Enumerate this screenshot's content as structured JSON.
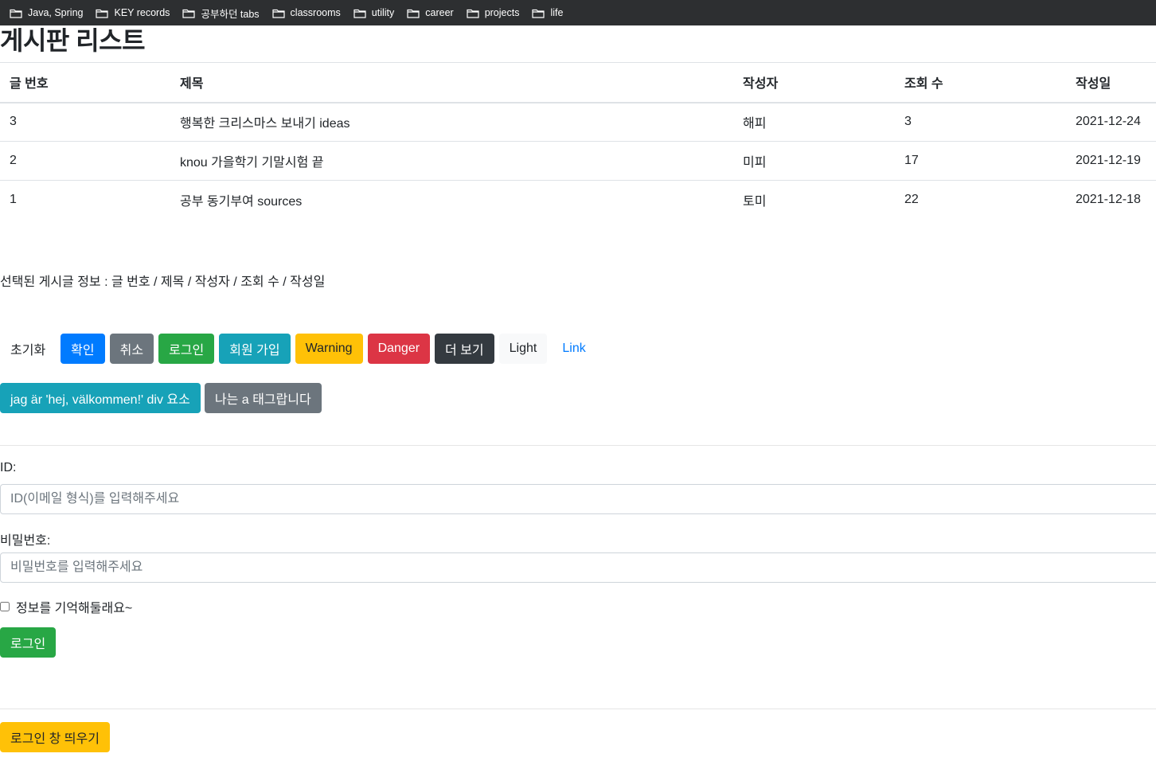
{
  "bookmarks": [
    {
      "label": "Java, Spring",
      "icon": "folder-icon"
    },
    {
      "label": "KEY records",
      "icon": "folder-icon"
    },
    {
      "label": "공부하던 tabs",
      "icon": "folder-icon"
    },
    {
      "label": "classrooms",
      "icon": "folder-icon"
    },
    {
      "label": "utility",
      "icon": "folder-icon"
    },
    {
      "label": "career",
      "icon": "folder-icon"
    },
    {
      "label": "projects",
      "icon": "folder-icon"
    },
    {
      "label": "life",
      "icon": "folder-icon"
    }
  ],
  "page": {
    "title": "게시판 리스트"
  },
  "table": {
    "headers": [
      "글 번호",
      "제목",
      "작성자",
      "조회 수",
      "작성일"
    ],
    "rows": [
      {
        "no": "3",
        "title": "행복한 크리스마스 보내기 ideas",
        "author": "해피",
        "views": "3",
        "date": "2021-12-24"
      },
      {
        "no": "2",
        "title": "knou 가을학기 기말시험 끝",
        "author": "미피",
        "views": "17",
        "date": "2021-12-19"
      },
      {
        "no": "1",
        "title": "공부 동기부여 sources",
        "author": "토미",
        "views": "22",
        "date": "2021-12-18"
      }
    ]
  },
  "selected_info": "선택된 게시글 정보 : 글 번호 / 제목 / 작성자 / 조회 수 / 작성일",
  "buttons_row1": {
    "reset": "초기화",
    "confirm": "확인",
    "cancel": "취소",
    "login": "로그인",
    "signup": "회원 가입",
    "warning": "Warning",
    "danger": "Danger",
    "more": "더 보기",
    "light": "Light",
    "link": "Link"
  },
  "buttons_row2": {
    "div_button": "jag är 'hej, välkommen!' div 요소",
    "a_button": "나는 a 태그랍니다"
  },
  "form": {
    "id_label": "ID:",
    "id_placeholder": "ID(이메일 형식)를 입력해주세요",
    "pw_label": "비밀번호:",
    "pw_placeholder": "비밀번호를 입력해주세요",
    "remember_label": "정보를 기억해둘래요~",
    "submit": "로그인"
  },
  "open_login": "로그인 창 띄우기",
  "colors": {
    "primary": "#007bff",
    "secondary": "#6c757d",
    "success": "#28a745",
    "info": "#17a2b8",
    "warning": "#ffc107",
    "danger": "#dc3545",
    "dark": "#343a40",
    "light": "#f8f9fa"
  }
}
